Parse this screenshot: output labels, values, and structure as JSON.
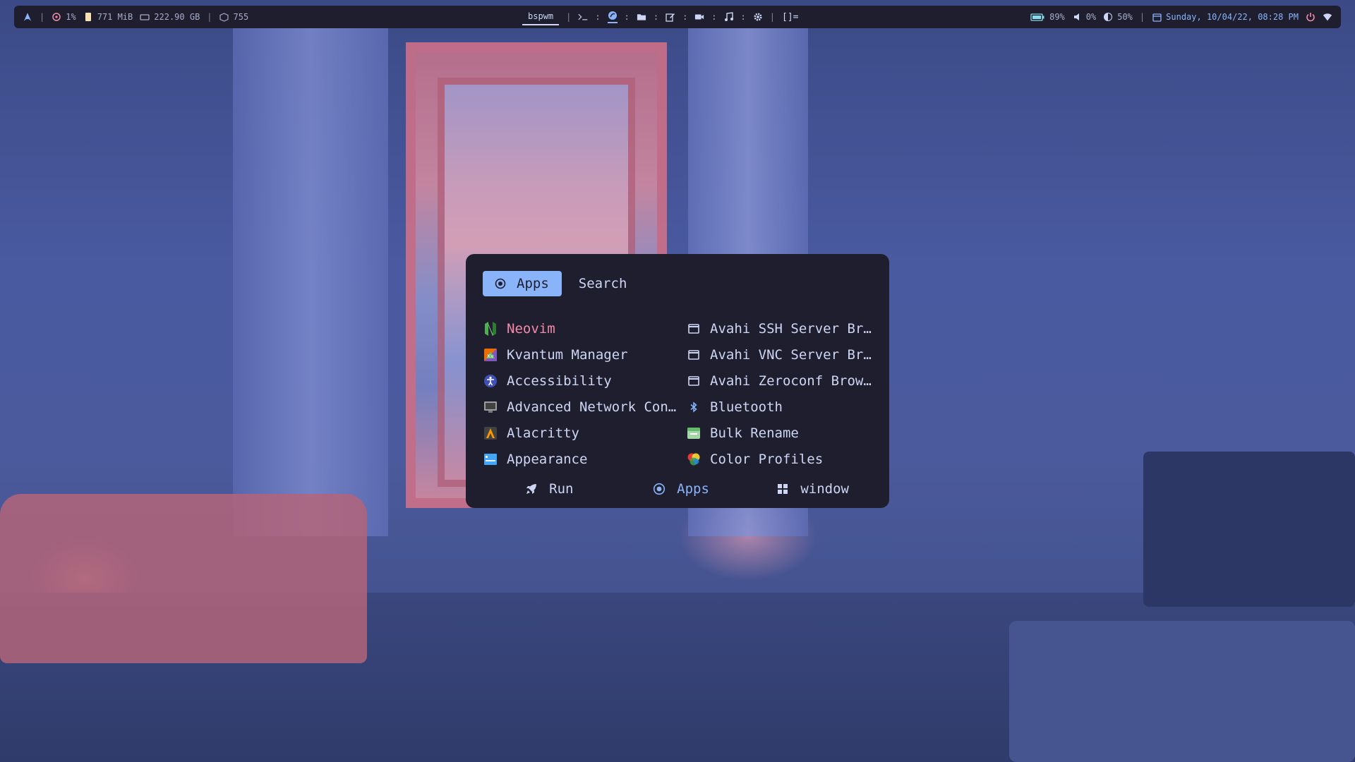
{
  "topbar": {
    "left": {
      "logo_icon": "arch-logo-icon",
      "cpu": "1%",
      "memory": "771 MiB",
      "disk": "222.90 GB",
      "packages": "755"
    },
    "center": {
      "workspace": "bspwm",
      "layout_indicator": "[]=",
      "apps": [
        "terminal-icon",
        "browser-icon",
        "folder-icon",
        "editor-icon",
        "video-icon",
        "music-icon",
        "settings-icon"
      ]
    },
    "right": {
      "battery": "89%",
      "volume": "0%",
      "brightness": "50%",
      "datetime": "Sunday, 10/04/22, 08:28 PM"
    }
  },
  "launcher": {
    "modes": [
      {
        "label": "Apps",
        "active": true
      },
      {
        "label": "Search",
        "active": false
      }
    ],
    "entries": [
      {
        "label": "Neovim",
        "selected": true,
        "icon": "neovim-icon"
      },
      {
        "label": "Avahi SSH Server Bro…",
        "icon": "window-icon"
      },
      {
        "label": "Kvantum Manager",
        "icon": "kvantum-icon"
      },
      {
        "label": "Avahi VNC Server Bro…",
        "icon": "window-icon"
      },
      {
        "label": "Accessibility",
        "icon": "accessibility-icon"
      },
      {
        "label": "Avahi Zeroconf Brows…",
        "icon": "window-icon"
      },
      {
        "label": "Advanced Network Con…",
        "icon": "network-icon"
      },
      {
        "label": "Bluetooth",
        "icon": "bluetooth-icon"
      },
      {
        "label": "Alacritty",
        "icon": "alacritty-icon"
      },
      {
        "label": "Bulk Rename",
        "icon": "bulk-rename-icon"
      },
      {
        "label": "Appearance",
        "icon": "appearance-icon"
      },
      {
        "label": "Color Profiles",
        "icon": "color-profiles-icon"
      }
    ],
    "bottom": [
      {
        "label": "Run",
        "icon": "rocket-icon"
      },
      {
        "label": "Apps",
        "icon": "apps-icon",
        "active": true
      },
      {
        "label": "window",
        "icon": "window-grid-icon"
      }
    ]
  },
  "colors": {
    "bar_bg": "#1e1e2e",
    "accent": "#89b4fa",
    "selected_text": "#f38ba8",
    "text": "#cdd6f4"
  }
}
